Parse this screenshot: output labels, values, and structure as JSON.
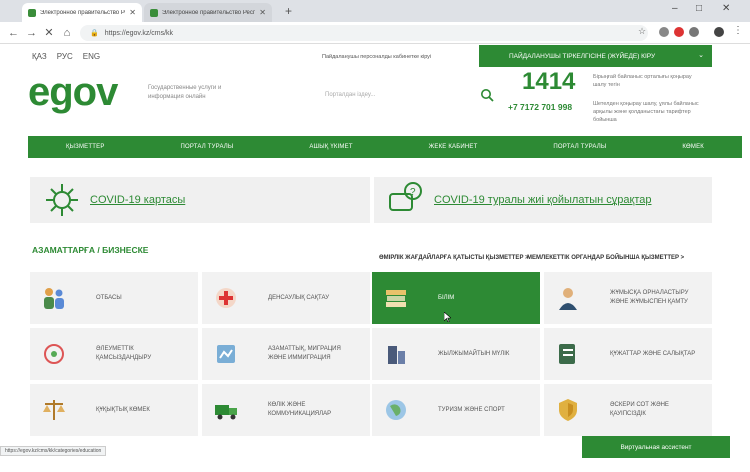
{
  "browser": {
    "tabs": [
      {
        "title": "Электронное правительство Республики Казахстан",
        "active": true
      },
      {
        "title": "Электронное правительство Республики Казахстан",
        "active": false
      }
    ],
    "url": "https://egov.kz/cms/kk"
  },
  "header": {
    "languages": [
      "ҚАЗ",
      "РУС",
      "ENG"
    ],
    "login_hint": "Пайдаланушы персоналды кабинетке кіруі",
    "login_button": "ПАЙДАЛАНУШЫ ТІРКЕЛГІСІНЕ (ЖҮЙЕДЕ) КІРУ",
    "logo_text": "egov",
    "logo_subtitle": "Государственные услуги и информация онлайн",
    "search_placeholder": "Порталдан іздеу...",
    "phone_short": "1414",
    "phone_short_desc": "Бірыңғай байланыс орталығы қоңырау шалу тегін",
    "phone_long": "+7 7172 701 998",
    "phone_long_desc": "Шетелден қоңырау шалу, ұялы байланыс арқылы және қолданыстағы тарифтер бойынша"
  },
  "nav": [
    "ҚЫЗМЕТТЕР",
    "ПОРТАЛ ТУРАЛЫ",
    "АШЫҚ ҮКІМЕТ",
    "ЖЕКЕ КАБИНЕТ",
    "ПОРТАЛ ТУРАЛЫ",
    "КӨМЕК"
  ],
  "covid": [
    {
      "label": "COVID-19 картасы"
    },
    {
      "label": "COVID-19 туралы жиі қойылатын сұрақтар"
    }
  ],
  "section": {
    "title": "АЗАМАТТАРҒА / БИЗНЕСКЕ",
    "link_left": "ӨМІРЛІК ЖАҒДАЙЛАРҒА ҚАТЫСТЫ ҚЫЗМЕТТЕР >",
    "link_right": "МЕМЛЕКЕТТІК ОРГАНДАР БОЙЫНША ҚЫЗМЕТТЕР >"
  },
  "categories": [
    {
      "label": "ОТБАСЫ",
      "icon": "family-icon",
      "active": false
    },
    {
      "label": "ДЕНСАУЛЫҚ САҚТАУ",
      "icon": "health-icon",
      "active": false
    },
    {
      "label": "БІЛІМ",
      "icon": "education-icon",
      "active": true
    },
    {
      "label": "ЖҰМЫСҚА ОРНАЛАСТЫРУ ЖӘНЕ ЖҰМЫСПЕН ҚАМТУ",
      "icon": "employment-icon",
      "active": false
    },
    {
      "label": "ӘЛЕУМЕТТІК ҚАМСЫЗДАНДЫРУ",
      "icon": "social-icon",
      "active": false
    },
    {
      "label": "АЗАМАТТЫҚ, МИГРАЦИЯ ЖӘНЕ ИММИГРАЦИЯ",
      "icon": "migration-icon",
      "active": false
    },
    {
      "label": "ЖЫЛЖЫМАЙТЫН МҮЛІК",
      "icon": "realty-icon",
      "active": false
    },
    {
      "label": "ҚҰЖАТТАР ЖӘНЕ САЛЫҚТАР",
      "icon": "documents-icon",
      "active": false
    },
    {
      "label": "ҚҰҚЫҚТЫҚ КӨМЕК",
      "icon": "legal-icon",
      "active": false
    },
    {
      "label": "КӨЛІК ЖӘНЕ КОММУНИКАЦИЯЛАР",
      "icon": "transport-icon",
      "active": false
    },
    {
      "label": "ТУРИЗМ ЖӘНЕ СПОРТ",
      "icon": "sport-icon",
      "active": false
    },
    {
      "label": "ӘСКЕРИ СОТ ЖӘНЕ ҚАУІПСІЗДІК",
      "icon": "security-icon",
      "active": false
    }
  ],
  "footer": {
    "status_url": "https://egov.kz/cms/kk/categories/education",
    "help_button": "Виртуальная ассистент"
  },
  "colors": {
    "brand": "#2d8a34",
    "tile": "#f2f2f2"
  }
}
